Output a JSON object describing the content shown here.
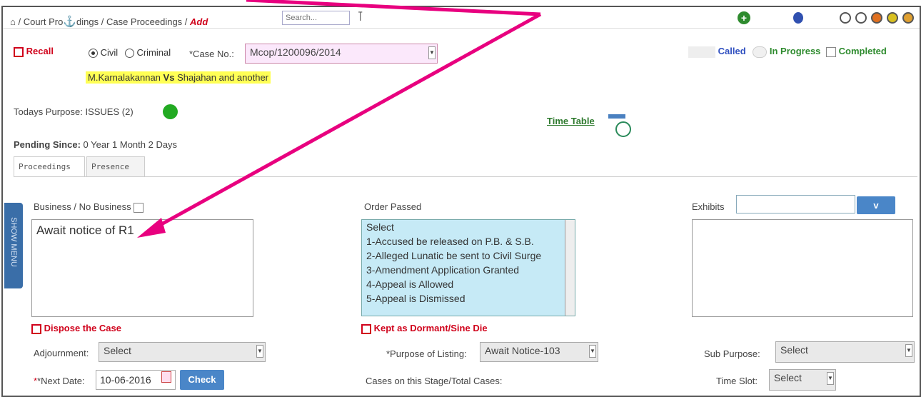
{
  "breadcrumb": {
    "part1": "/ Court Pro",
    "part2": "dings / Case Proceedings /",
    "current": "Add"
  },
  "search": {
    "placeholder": "Search..."
  },
  "header_status": {
    "called": "Called",
    "in_progress": "In Progress",
    "completed": "Completed"
  },
  "recall_label": "Recall",
  "case_type": {
    "civil": "Civil",
    "criminal": "Criminal",
    "selected": "Civil"
  },
  "case_no": {
    "label": "*Case No.:",
    "value": "Mcop/1200096/2014"
  },
  "parties": {
    "petitioner": "M.Karnalakannan",
    "vs": "Vs",
    "respondent": "Shajahan and another"
  },
  "todays_purpose": {
    "label": "Todays Purpose:",
    "value": "ISSUES (2)"
  },
  "time_table_link": "Time Table",
  "pending_since": {
    "label": "Pending Since:",
    "value": "0 Year 1 Month 2 Days"
  },
  "tabs": [
    {
      "label": "Proceedings"
    },
    {
      "label": "Presence"
    }
  ],
  "side_menu_label": "SHOW MENU",
  "business": {
    "label": "Business / No Business",
    "text": "Await notice of R1"
  },
  "order_passed": {
    "label": "Order Passed",
    "options": [
      "Select",
      "1-Accused be released on P.B. & S.B.",
      "2-Alleged Lunatic be sent to Civil Surge",
      "3-Amendment Application Granted",
      "4-Appeal is Allowed",
      "5-Appeal is Dismissed"
    ]
  },
  "exhibits": {
    "label": "Exhibits",
    "button": "v"
  },
  "dispose_label": "Dispose the Case",
  "dormant_label": "Kept as Dormant/Sine Die",
  "adjournment": {
    "label": "Adjournment:",
    "value": "Select"
  },
  "purpose_of_listing": {
    "label": "*Purpose of Listing:",
    "value": "Await Notice-103"
  },
  "sub_purpose": {
    "label": "Sub Purpose:",
    "value": "Select"
  },
  "next_date": {
    "label": "*Next Date:",
    "value": "10-06-2016"
  },
  "check_button": "Check",
  "cases_stage": {
    "label": "Cases on this Stage/Total Cases:"
  },
  "time_slot": {
    "label": "Time Slot:",
    "value": "Select"
  },
  "colors": {
    "accent_red": "#d0021b",
    "arrow_magenta": "#e8007f",
    "highlight_yellow": "#ffff55",
    "list_blue": "#c6eaf6",
    "button_blue": "#4a86c8"
  }
}
